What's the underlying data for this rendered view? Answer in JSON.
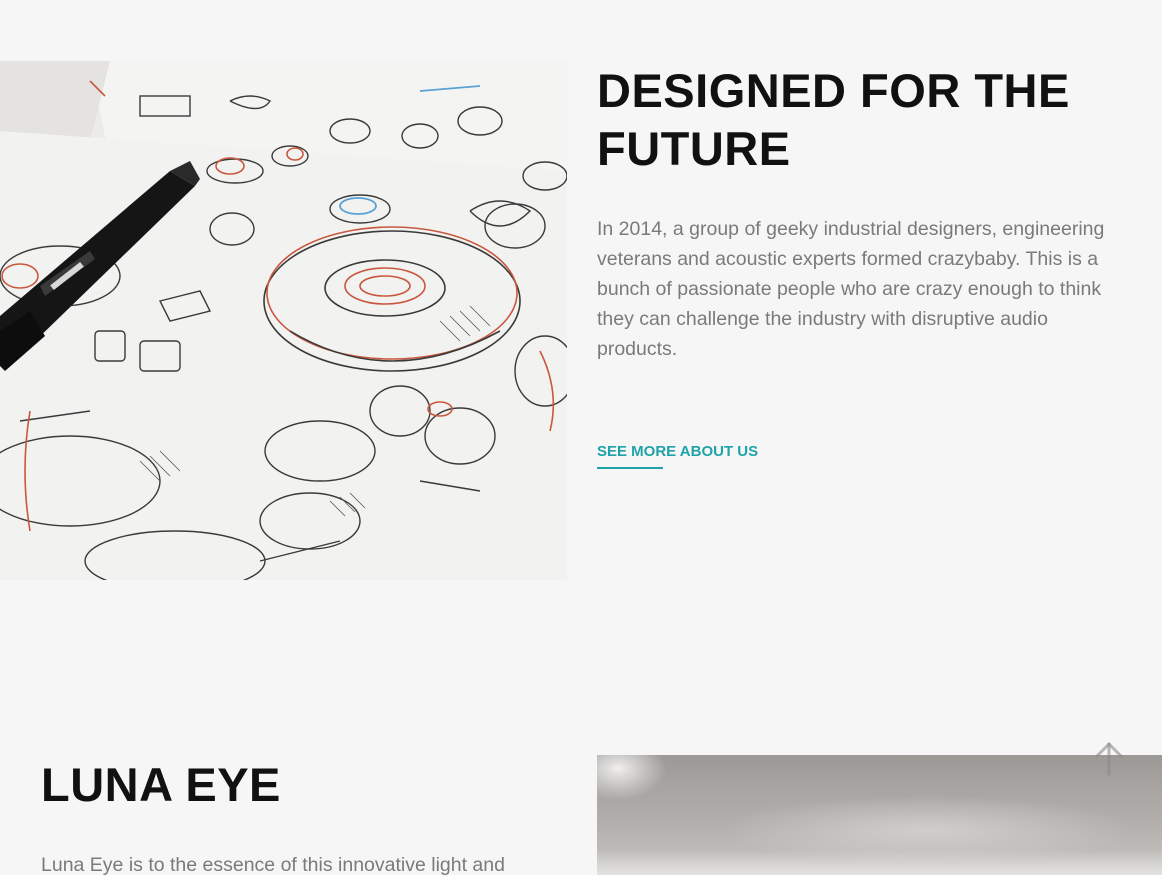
{
  "about_section": {
    "image_alt": "sketch-drawings-image",
    "title": "DESIGNED FOR THE FUTURE",
    "description": "In 2014, a group of geeky industrial designers, engineering veterans and acoustic experts formed crazybaby. This is a bunch of passionate people who are crazy enough to think they can challenge the industry with disruptive audio products.",
    "link_label": "SEE MORE ABOUT US"
  },
  "luna_section": {
    "title": "LUNA EYE",
    "description": "Luna Eye is to the essence of this innovative light and"
  },
  "scroll_top": {
    "icon": "arrow-up-icon"
  },
  "colors": {
    "background": "#f6f6f6",
    "heading": "#111111",
    "body_text": "#7a7a7a",
    "accent": "#1fa3a8"
  }
}
